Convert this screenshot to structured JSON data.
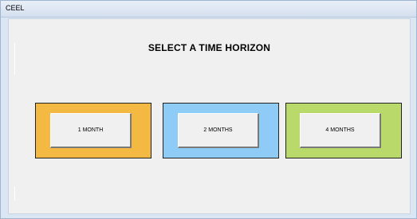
{
  "window": {
    "title": "CEEL"
  },
  "form": {
    "heading": "SELECT A TIME HORIZON",
    "options": [
      {
        "label": "1 MONTH",
        "color": "#f4b942"
      },
      {
        "label": "2 MONTHS",
        "color": "#8ecbf7"
      },
      {
        "label": "4 MONTHS",
        "color": "#b9d96b"
      }
    ]
  }
}
